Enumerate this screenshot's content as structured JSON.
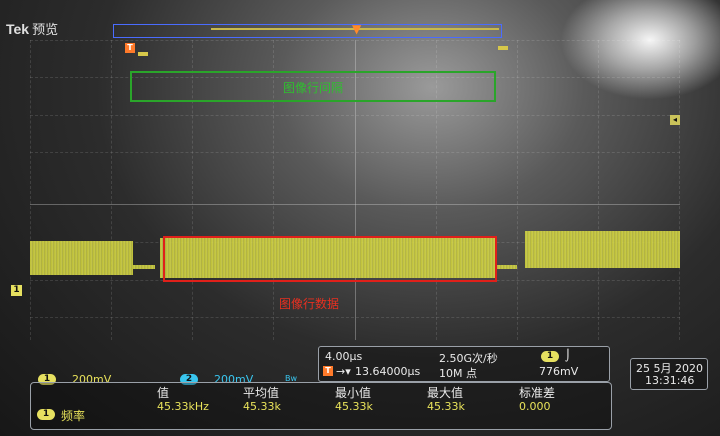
{
  "header": {
    "brand": "Tek",
    "mode": "预览"
  },
  "annotations": {
    "green_label": "图像行间隔",
    "red_label": "图像行数据"
  },
  "channels": {
    "ch1_number": "1",
    "ch1_scale": "200mV",
    "ch2_number": "2",
    "ch2_scale": "200mV",
    "bw_glyph": "Bw"
  },
  "timebase": {
    "horizontal_scale": "4.00µs",
    "sample_rate": "2.50G次/秒",
    "trigger_label": "T",
    "trigger_delay": "13.64000µs",
    "record_length": "10M 点",
    "trigger_channel": "1",
    "trigger_slope": "⌡",
    "trigger_level": "776mV"
  },
  "measurements": {
    "headers": [
      "值",
      "平均值",
      "最小值",
      "最大值",
      "标准差"
    ],
    "channel": "1",
    "name": "频率",
    "values": [
      "45.33kHz",
      "45.33k",
      "45.33k",
      "45.33k",
      "0.000"
    ]
  },
  "datetime": {
    "date": "25 5月 2020",
    "time": "13:31:46"
  },
  "colors": {
    "ch1": "#e6e060",
    "ch2": "#39c6ef",
    "green_box": "#2aa52a",
    "red_box": "#e0201a",
    "trigger": "#ff7a2a"
  }
}
